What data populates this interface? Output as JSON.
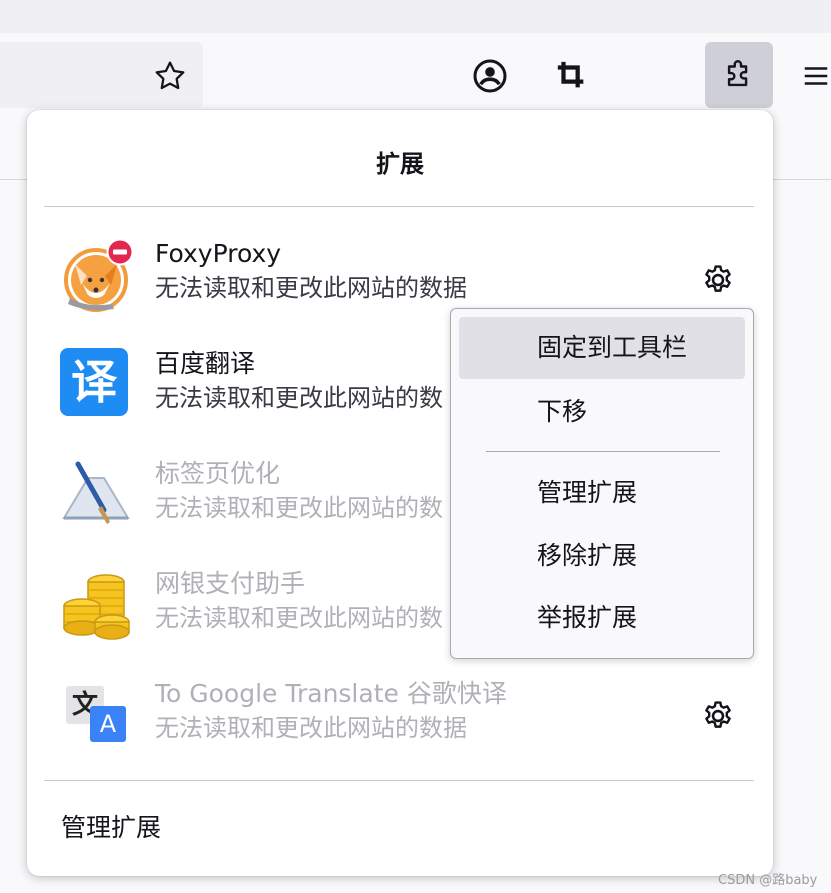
{
  "toolbar": {
    "icons": [
      "star-icon",
      "account-icon",
      "crop-icon",
      "extensions-icon",
      "hamburger-menu-icon"
    ]
  },
  "panel": {
    "title": "扩展",
    "extensions": [
      {
        "name": "FoxyProxy",
        "desc": "无法读取和更改此网站的数据",
        "enabled": true,
        "icon": "foxyproxy-icon",
        "badge": "blocked-badge-icon",
        "has_settings": true
      },
      {
        "name": "百度翻译",
        "desc": "无法读取和更改此网站的数",
        "enabled": true,
        "icon": "baidu-translate-icon",
        "icon_text": "译",
        "has_settings": false
      },
      {
        "name": "标签页优化",
        "desc": "无法读取和更改此网站的数",
        "enabled": false,
        "icon": "tab-optimizer-icon",
        "has_settings": false
      },
      {
        "name": "网银支付助手",
        "desc": "无法读取和更改此网站的数",
        "enabled": false,
        "icon": "coins-icon",
        "has_settings": false
      },
      {
        "name": "To Google Translate 谷歌快译",
        "desc": "无法读取和更改此网站的数据",
        "enabled": false,
        "icon": "google-translate-icon",
        "icon_text": "文",
        "icon_text2": "A",
        "has_settings": true
      }
    ],
    "manage_label": "管理扩展"
  },
  "context_menu": {
    "items": [
      {
        "label": "固定到工具栏",
        "highlighted": true
      },
      {
        "label": "下移",
        "highlighted": false
      },
      {
        "label": "管理扩展",
        "highlighted": false
      },
      {
        "label": "移除扩展",
        "highlighted": false
      },
      {
        "label": "举报扩展",
        "highlighted": false
      }
    ]
  },
  "watermark": "CSDN @路baby",
  "colors": {
    "accent_blue": "#1f8cf3",
    "disabled_text": "#b0b0b7",
    "menu_highlight": "#e0e0e6",
    "blocked_red": "#e22850"
  }
}
